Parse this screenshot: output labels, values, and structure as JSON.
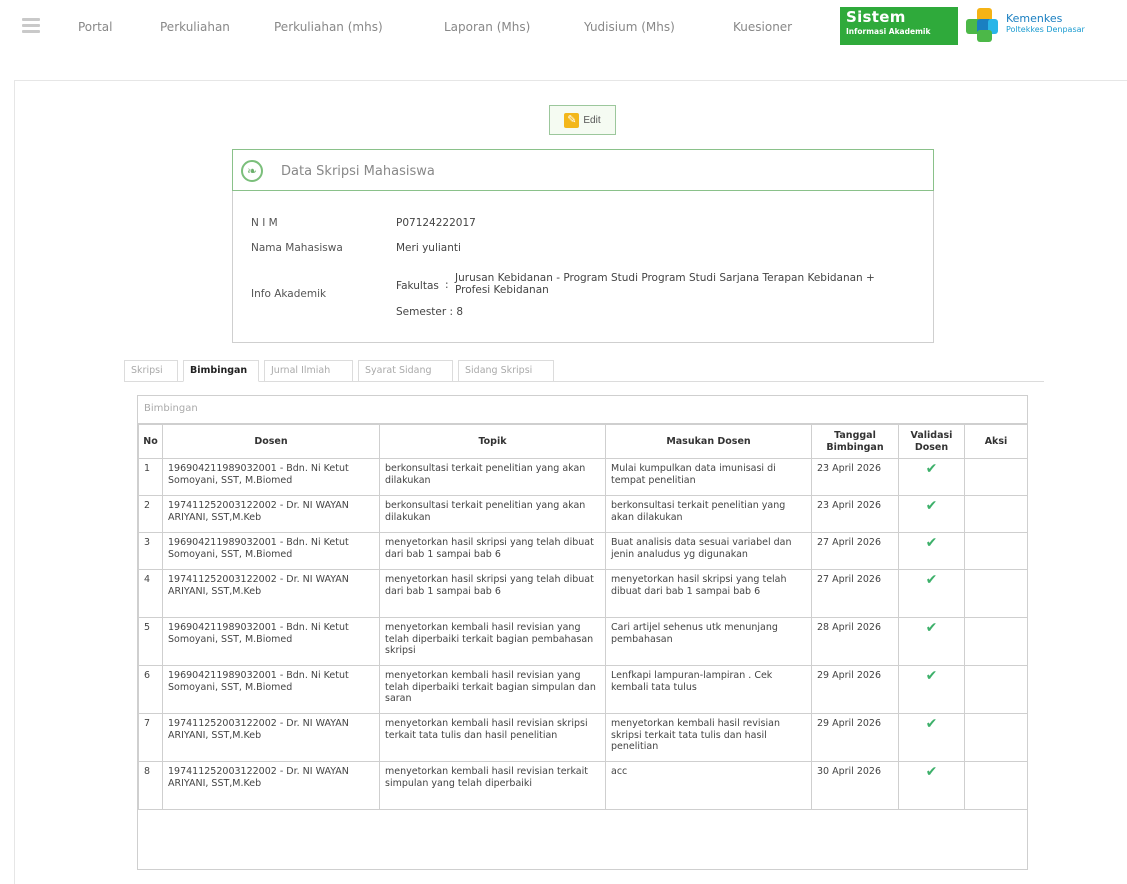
{
  "nav": {
    "items": [
      "Portal",
      "Perkuliahan",
      "Perkuliahan (mhs)",
      "Laporan (Mhs)",
      "Yudisium (Mhs)",
      "Kuesioner"
    ]
  },
  "brand": {
    "sistem_line1": "Sistem",
    "sistem_line2": "Informasi Akademik",
    "kemenkes_line1": "Kemenkes",
    "kemenkes_line2": "Poltekkes Denpasar",
    "colors": {
      "sistem_green": "#2faa3b",
      "kemenkes_blue": "#1a7fc1",
      "kemenkes_green": "#4cb848",
      "kemenkes_yellow": "#f5b315",
      "kemenkes_cyan": "#29b5e8"
    }
  },
  "toolbar": {
    "edit_label": "Edit"
  },
  "skripsi": {
    "title": "Data Skripsi Mahasiswa",
    "nim_label": "N I M",
    "nim": "P07124222017",
    "nama_label": "Nama Mahasiswa",
    "nama": "Meri yulianti",
    "info_label": "Info Akademik",
    "fakultas_label": "Fakultas",
    "fakultas_sep": ":",
    "fakultas": "Jurusan Kebidanan - Program Studi Program Studi Sarjana Terapan Kebidanan + Profesi Kebidanan",
    "semester_text": "Semester : 8"
  },
  "tabs": [
    "Skripsi",
    "Bimbingan",
    "Jurnal Ilmiah",
    "Syarat Sidang",
    "Sidang Skripsi"
  ],
  "active_tab": "Bimbingan",
  "table": {
    "caption": "Bimbingan",
    "headers": [
      "No",
      "Dosen",
      "Topik",
      "Masukan Dosen",
      "Tanggal Bimbingan",
      "Validasi Dosen",
      "Aksi"
    ],
    "validated_icon": "check-icon",
    "rows": [
      {
        "no": "1",
        "dosen": "196904211989032001 - Bdn. Ni Ketut Somoyani, SST, M.Biomed",
        "topik": "berkonsultasi terkait penelitian yang akan dilakukan",
        "masukan": "Mulai kumpulkan data imunisasi di tempat penelitian",
        "tanggal": "23 April 2026",
        "valid": "✔",
        "aksi": ""
      },
      {
        "no": "2",
        "dosen": "197411252003122002 - Dr. NI WAYAN ARIYANI, SST,M.Keb",
        "topik": "berkonsultasi terkait penelitian yang akan dilakukan",
        "masukan": "berkonsultasi terkait penelitian yang akan dilakukan",
        "tanggal": "23 April 2026",
        "valid": "✔",
        "aksi": ""
      },
      {
        "no": "3",
        "dosen": "196904211989032001 - Bdn. Ni Ketut Somoyani, SST, M.Biomed",
        "topik": "menyetorkan hasil skripsi yang telah dibuat dari bab 1 sampai bab 6",
        "masukan": "Buat analisis data sesuai variabel dan jenin analudus yg digunakan",
        "tanggal": "27 April 2026",
        "valid": "✔",
        "aksi": ""
      },
      {
        "no": "4",
        "dosen": "197411252003122002 - Dr. NI WAYAN ARIYANI, SST,M.Keb",
        "topik": "menyetorkan hasil skripsi yang telah dibuat dari bab 1 sampai bab 6",
        "masukan": "menyetorkan hasil skripsi yang telah dibuat dari bab 1 sampai bab 6",
        "tanggal": "27 April 2026",
        "valid": "✔",
        "aksi": ""
      },
      {
        "no": "5",
        "dosen": "196904211989032001 - Bdn. Ni Ketut Somoyani, SST, M.Biomed",
        "topik": "menyetorkan kembali hasil revisian yang telah diperbaiki terkait bagian pembahasan skripsi",
        "masukan": "Cari artijel sehenus utk menunjang pembahasan",
        "tanggal": "28 April 2026",
        "valid": "✔",
        "aksi": ""
      },
      {
        "no": "6",
        "dosen": "196904211989032001 - Bdn. Ni Ketut Somoyani, SST, M.Biomed",
        "topik": "menyetorkan kembali hasil revisian yang telah diperbaiki terkait bagian simpulan dan saran",
        "masukan": "Lenfkapi lampuran-lampiran . Cek kembali tata tulus",
        "tanggal": "29 April 2026",
        "valid": "✔",
        "aksi": ""
      },
      {
        "no": "7",
        "dosen": "197411252003122002 - Dr. NI WAYAN ARIYANI, SST,M.Keb",
        "topik": "menyetorkan kembali hasil revisian skripsi terkait tata tulis dan hasil penelitian",
        "masukan": "menyetorkan kembali hasil revisian skripsi terkait tata tulis dan hasil penelitian",
        "tanggal": "29 April 2026",
        "valid": "✔",
        "aksi": ""
      },
      {
        "no": "8",
        "dosen": "197411252003122002 - Dr. NI WAYAN ARIYANI, SST,M.Keb",
        "topik": "menyetorkan kembali hasil revisian terkait simpulan yang telah diperbaiki",
        "masukan": "acc",
        "tanggal": "30 April 2026",
        "valid": "✔",
        "aksi": ""
      }
    ]
  }
}
